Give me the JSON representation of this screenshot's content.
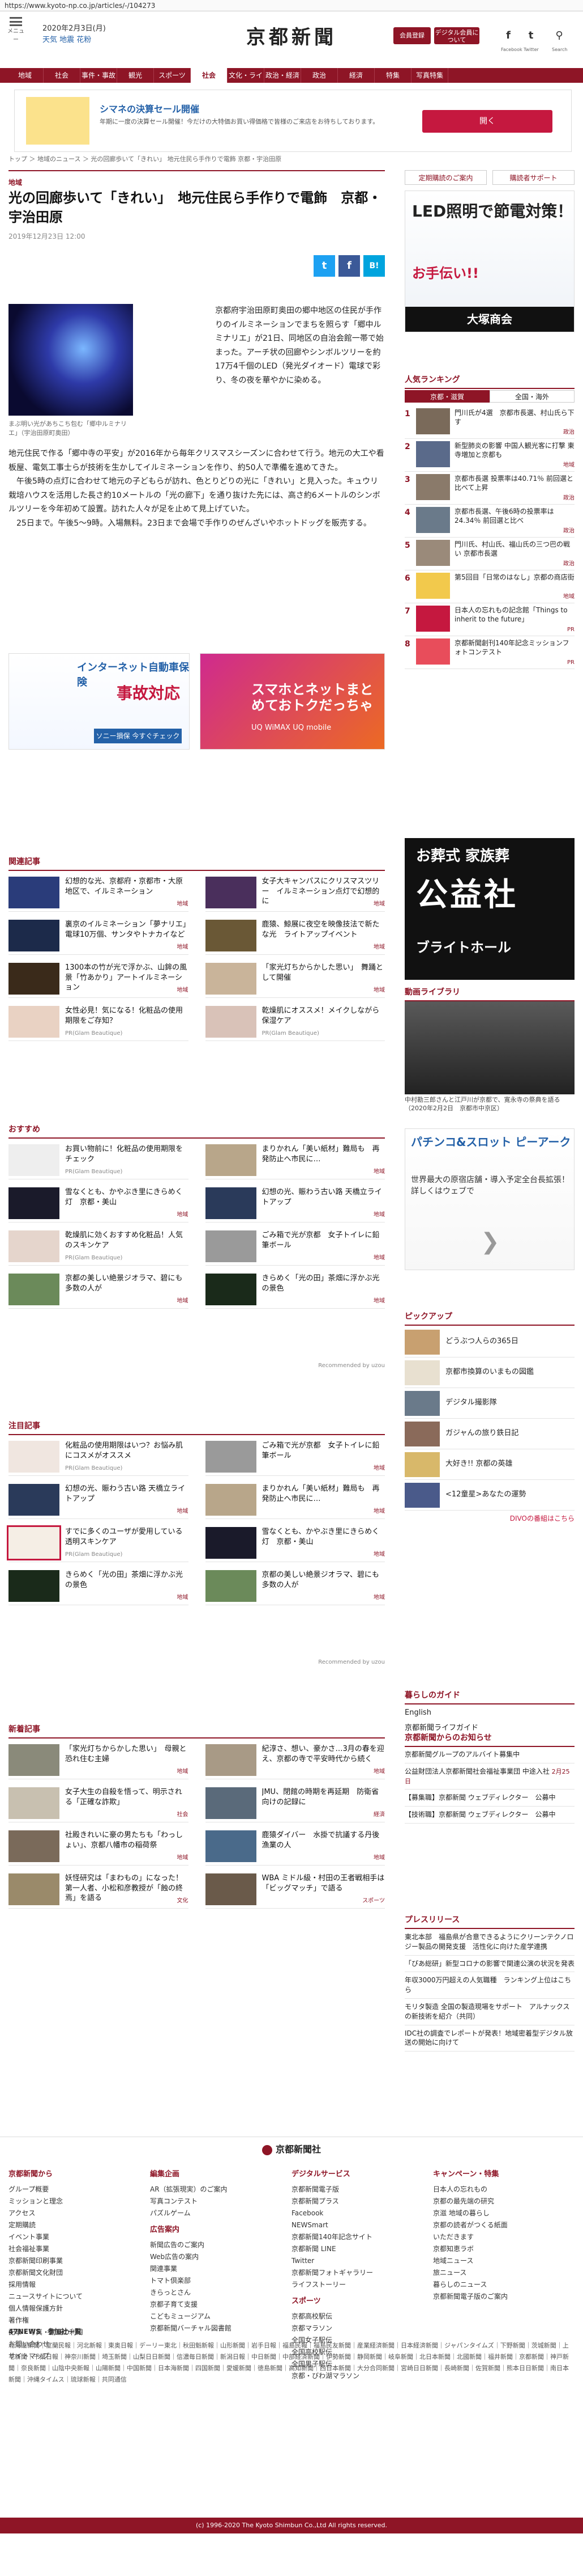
{
  "browser": {
    "url": "https://www.kyoto-np.co.jp/articles/-/104273"
  },
  "header": {
    "menu_label": "メニュー",
    "date": "2020年2月3日(月)",
    "weather": "天気 地震 花粉",
    "logo": "京都新聞",
    "btn_login": "会員登録",
    "btn_digital": "デジタル会員について",
    "facebook_label": "Facebook",
    "twitter_label": "Twitter",
    "search_label": "Search"
  },
  "nav": [
    "地域",
    "社会",
    "事件・事故",
    "観光",
    "スポーツ",
    "社会",
    "文化・ライフ",
    "政治・経済",
    "政治",
    "経済",
    "特集",
    "写真特集"
  ],
  "banner": {
    "title": "シマネの決算セール開催",
    "sub": "年期に一度の決算セール開催！今だけの大特価お買い得価格で皆様のご来店をお待ちしております。",
    "button": "開く"
  },
  "breadcrumb": "トップ ＞ 地域のニュース ＞ 光の回廊歩いて「きれい」 地元住民ら手作りで電飾 京都・宇治田原",
  "article": {
    "category": "地域",
    "title": "光の回廊歩いて「きれい」　地元住民ら手作りで電飾　京都・宇治田原",
    "date": "2019年12月23日 12:00",
    "share_twitter": "t",
    "share_facebook": "f",
    "share_hatena": "B!",
    "caption": "まぶ明い光があちこち包む「郷中ルミナリエ」（宇治田原町奥田）",
    "body1": "京都府宇治田原町奥田の郷中地区の住民が手作りのイルミネーションでまちを照らす「郷中ルミナリエ」が21日、同地区の自治会館一帯で始まった。アーチ状の回廊やシンボルツリーを約17万4千個のLED（発光ダイオード）電球で彩り、冬の夜を華やかに染める。",
    "body2": "地元住民で作る「郷中寺の平安」が2016年から毎年クリスマスシーズンに合わせて行う。地元の大工や看板屋、電気工事士らが技術を生かしてイルミネーションを作り、約50人で準備を進めてきた。\n　午後5時の点灯に合わせて地元の子どもらが訪れ、色とりどりの光に「きれい」と見入った。キュウリ栽培ハウスを活用した長さ約10メートルの「光の廊下」を通り抜けた先には、高さ約6メートルのシンボルツリーを今年初めて設置。訪れた人々が足を止めて見上げていた。\n　25日まで。午後5～9時。入場無料。23日まで会場で手作りのぜんざいやホットドッグを販売する。"
  },
  "ads": {
    "a1_title": "インターネット自動車保険",
    "a1_big": "事故対応",
    "a1_btn": "ソニー損保 今すぐチェック",
    "a2_title": "スマホとネットまとめておトクだっちゃ",
    "a2_sub": "UQ WiMAX UQ mobile"
  },
  "related": {
    "heading": "関連記事",
    "items": [
      {
        "t": "幻想的な光、京都府・京都市・大原地区で、イルミネーション",
        "tag": "地域"
      },
      {
        "t": "女子大キャンパスにクリスマスツリー　イルミネーション点灯で幻想的に",
        "tag": "地域"
      },
      {
        "t": "裏京のイルミネーション「夢ナリエ」　電球10万個、サンタやトナカイなど",
        "tag": "地域"
      },
      {
        "t": "鹿猿、鯨展に夜空を映像技法で新たな光　ライトアップイベント",
        "tag": "地域"
      },
      {
        "t": "1300本の竹が光で浮かぶ、山鉾の風景「竹あかり」アートイルミネーション",
        "tag": "地域"
      },
      {
        "t": "「家光灯ちからかした思い」　舞踊として開催",
        "tag": "地域"
      },
      {
        "t": "女性必見！気になる！化粧品の使用期限をご存知？",
        "tag": "PR(Glam Beautique)"
      },
      {
        "t": "乾燥肌にオススメ！メイクしながら保湿ケア",
        "tag": "PR(Glam Beautique)"
      }
    ]
  },
  "osusume": {
    "heading": "おすすめ",
    "items": [
      {
        "t": "お買い物前に！化粧品の使用期限をチェック",
        "tag": "PR(Glam Beautique)"
      },
      {
        "t": "まりかれん「美い紙材」難局も　再発防止へ市民に…",
        "tag": "地域"
      },
      {
        "t": "雪なくとも、かやぶき里にきらめく灯　京都・美山",
        "tag": "地域"
      },
      {
        "t": "幻想の光、賑わう古い路 天橋立ライトアップ",
        "tag": "地域"
      },
      {
        "t": "乾燥肌に効くおすすめ化粧品！人気のスキンケア",
        "tag": "PR(Glam Beautique)"
      },
      {
        "t": "ごみ箱で光が京都　女子トイレに鉛筆ボール",
        "tag": "地域"
      },
      {
        "t": "京都の美しい絶景ジオラマ、碧にも多数の人が",
        "tag": "地域"
      },
      {
        "t": "きらめく「光の田」茶畑に浮かぶ光の景色",
        "tag": "地域"
      }
    ],
    "credit": "Recommended by uzou"
  },
  "chumoku": {
    "heading": "注目記事",
    "items": [
      {
        "t": "化粧品の使用期限はいつ？お悩み肌にコスメがオススメ",
        "tag": "PR(Glam Beautique)"
      },
      {
        "t": "ごみ箱で光が京都　女子トイレに鉛筆ボール",
        "tag": "地域"
      },
      {
        "t": "幻想の光、賑わう古い路 天橋立ライトアップ",
        "tag": "地域"
      },
      {
        "t": "まりかれん「美い紙材」難局も　再発防止へ市民に…",
        "tag": "地域"
      },
      {
        "t": "すでに多くのユーザが愛用している透明スキンケア",
        "tag": "PR(Glam Beautique)"
      },
      {
        "t": "雪なくとも、かやぶき里にきらめく灯　京都・美山",
        "tag": "地域"
      },
      {
        "t": "きらめく「光の田」茶畑に浮かぶ光の景色",
        "tag": "地域"
      },
      {
        "t": "京都の美しい絶景ジオラマ、碧にも多数の人が",
        "tag": "地域"
      }
    ],
    "credit": "Recommended by uzou"
  },
  "latest": {
    "heading": "新着記事",
    "items": [
      {
        "t": "「家光灯ちからかした思い」　母親と恐れ住む主婦",
        "tag": "地域"
      },
      {
        "t": "紀淳さ、想い、豪かさ…3月の春を迎え、京都の寺で平安時代から続く",
        "tag": "地域"
      },
      {
        "t": "女子大生の自殺を悟って、明示される「正確な詐欺」",
        "tag": "社会"
      },
      {
        "t": "JMU、閉館の時期を再延期　防衛省向けの記録に",
        "tag": "経済"
      },
      {
        "t": "社殿きれいに豪の男たちも「わっしょい」、京都八幡市の稲荷祭",
        "tag": "地域"
      },
      {
        "t": "鹿猿ダイバー　水掛で抗議する丹後漁業の人",
        "tag": "地域"
      },
      {
        "t": "妖怪研究は「まわもの」になった！第一人者、小松和彦教授が「蝕の終焉」を語る",
        "tag": "文化"
      },
      {
        "t": "WBA ミドル級・村田の王者戦相手は「ビッグマッチ」で語る",
        "tag": "スポーツ"
      }
    ]
  },
  "sidebar": {
    "btn1": "定期購読のご案内",
    "btn2": "購読者サポート",
    "ad1_big": "LED照明で節電対策！",
    "ad1_red": "お手伝い!!",
    "ad1_bar": "大塚商会",
    "ranking_heading": "人気ランキング",
    "tab1": "京都・滋賀",
    "tab2": "全国・海外",
    "ranking": [
      {
        "t": "門川氏が4選　京都市長選、村山氏ら下す",
        "tag": "政治"
      },
      {
        "t": "新型肺炎の影響 中国人観光客に打撃 東寺増加と京都も",
        "tag": "地域"
      },
      {
        "t": "京都市長選 投票率は40.71％ 前回選と比べて上昇",
        "tag": "政治"
      },
      {
        "t": "京都市長選、午後6時の投票率は24.34％ 前回選と比べ",
        "tag": "政治"
      },
      {
        "t": "門川氏、村山氏、福山氏の三つ巴の戦い 京都市長選",
        "tag": "政治"
      },
      {
        "t": "第5回目「日常のはなし」京都の商店街",
        "tag": "地域"
      },
      {
        "t": "日本人の忘れもの記念館「Things to inherit to the future」",
        "tag": "PR"
      },
      {
        "t": "京都新聞創刊140年記念ミッションフォトコンテスト",
        "tag": "PR"
      }
    ],
    "funeral_a": "お葬式 家族葬",
    "funeral_b": "公益社",
    "funeral_c": "ブライトホール",
    "video_heading": "動画ライブラリ",
    "video_caption": "中村勘三郎さんと江戸川が京都で、寛永寺の祭典を語る（2020年2月2日　京都市中京区）",
    "pachi_title": "パチンコ&スロット ピーアーク",
    "pachi_sub": "世界最大の原宿店舗・導入予定全台長拡張！詳しくはウェブで",
    "pachi_arrow": "❯",
    "pickup_heading": "ピックアップ",
    "pickup": [
      {
        "t": "どうぶつ人らの365日"
      },
      {
        "t": "京都市換算のいまもの図鑑"
      },
      {
        "t": "デジタル撮影隊"
      },
      {
        "t": "ガジャんの旅り鉄日記"
      },
      {
        "t": "大好き!! 京都の英雄"
      },
      {
        "t": "<12童星>あなたの運勢"
      }
    ],
    "pickup_link": "DIVOの番組はこちら",
    "guide_heading": "暮らしのガイド",
    "guide": [
      "English",
      "京都新聞ライフガイド"
    ],
    "shinbun_heading": "京都新聞からのお知らせ",
    "shinbun": [
      {
        "t": "京都新聞グループのアルバイト募集中",
        "dt": ""
      },
      {
        "t": "公益財団法人京都新聞社会福祉事業団 中途入社",
        "dt": "2月25日"
      },
      {
        "t": "【募集職】京都新聞 ウェブディレクター　公募中",
        "dt": ""
      },
      {
        "t": "【技術職】京都新聞 ウェブディレクター　公募中",
        "dt": ""
      }
    ],
    "press_heading": "プレスリリース",
    "press": [
      {
        "t": "東北本部　福島県が合意できるようにクリーンテクノロジー製品の開発支援　活性化に向けた産学連携",
        "dt": ""
      },
      {
        "t": "「ぴあ総研」新型コロナの影響で関連公演の状況を発表",
        "dt": ""
      },
      {
        "t": "年収3000万円超えの人気職種　ランキング上位はこちら",
        "dt": ""
      },
      {
        "t": "モリタ製造 全国の製造現場をサポート　アルナックスの新技術を紹介（共同）",
        "dt": ""
      },
      {
        "t": "IDC社の調査でレポートが発表！地域密着型デジタル放送の開始に向けて",
        "dt": ""
      }
    ]
  },
  "footer": {
    "logo": "京都新聞社",
    "cols": [
      {
        "h": "京都新聞から",
        "items": [
          "グループ概要",
          "ミッションと理念",
          "アクセス",
          "定期購読",
          "イベント事業",
          "社会福祉事業",
          "京都新聞印刷事業",
          "京都新聞文化財団",
          "採用情報",
          "ニュースサイトについて",
          "個人情報保護方針",
          "著作権",
          "記事・写真・動画の利用",
          "お問い合わせ",
          "サイトマップ"
        ]
      },
      {
        "h": "編集企画",
        "items": [
          "AR（拡張現実）のご案内",
          "写真コンテスト",
          "パズルゲーム"
        ],
        "h2": "広告案内",
        "items2": [
          "新聞広告のご案内",
          "Web広告の案内",
          "関連事業",
          "トマト倶楽部",
          "きらっとさん",
          "京都子育て支援",
          "こどもミュージアム",
          "京都新聞バーチャル図書館"
        ]
      },
      {
        "h": "デジタルサービス",
        "items": [
          "京都新聞電子版",
          "京都新聞プラス",
          "Facebook",
          "NEWSmart",
          "京都新聞140年記念サイト",
          "京都新聞 LINE",
          "Twitter",
          "京都新聞フォトギャラリー",
          "ライフストーリー"
        ],
        "h2": "スポーツ",
        "items2": [
          "京都高校駅伝",
          "京都マラソン",
          "全国女子駅伝",
          "全国高校駅伝",
          "全国男子駅伝",
          "京都・びわ湖マラソン"
        ]
      },
      {
        "h": "キャンペーン・特集",
        "items": [
          "日本人の忘れもの",
          "京都の最先端の研究",
          "京滋 地域の暮らし",
          "京都の読者がつくる紙面",
          "いただきます",
          "京都知恵ラボ",
          "地域ニュース",
          "旅ニュース",
          "暮らしのニュース",
          "京都新聞電子版のご案内"
        ]
      }
    ],
    "n47_heading": "47NEWS　参加社一覧",
    "n47_links": "北海道新聞｜室蘭民報｜河北新報｜東奥日報｜デーリー東北｜秋田魁新報｜山形新聞｜岩手日報｜福島民報｜福島民友新聞｜産業経済新聞｜日本経済新聞｜ジャパンタイムズ｜下野新聞｜茨城新聞｜上毛新聞｜千葉日報｜神奈川新聞｜埼玉新聞｜山梨日日新聞｜信濃毎日新聞｜新潟日報｜中日新聞｜中部経済新聞｜伊勢新聞｜静岡新聞｜岐阜新聞｜北日本新聞｜北國新聞｜福井新聞｜京都新聞｜神戸新聞｜奈良新聞｜山陰中央新報｜山陽新聞｜中国新聞｜日本海新聞｜四国新聞｜愛媛新聞｜徳島新聞｜高知新聞｜西日本新聞｜大分合同新聞｜宮崎日日新聞｜長崎新聞｜佐賀新聞｜熊本日日新聞｜南日本新聞｜沖縄タイムス｜琉球新報｜共同通信",
    "copyright": "(c) 1996-2020 The Kyoto Shimbun Co.,Ltd All rights reserved."
  }
}
